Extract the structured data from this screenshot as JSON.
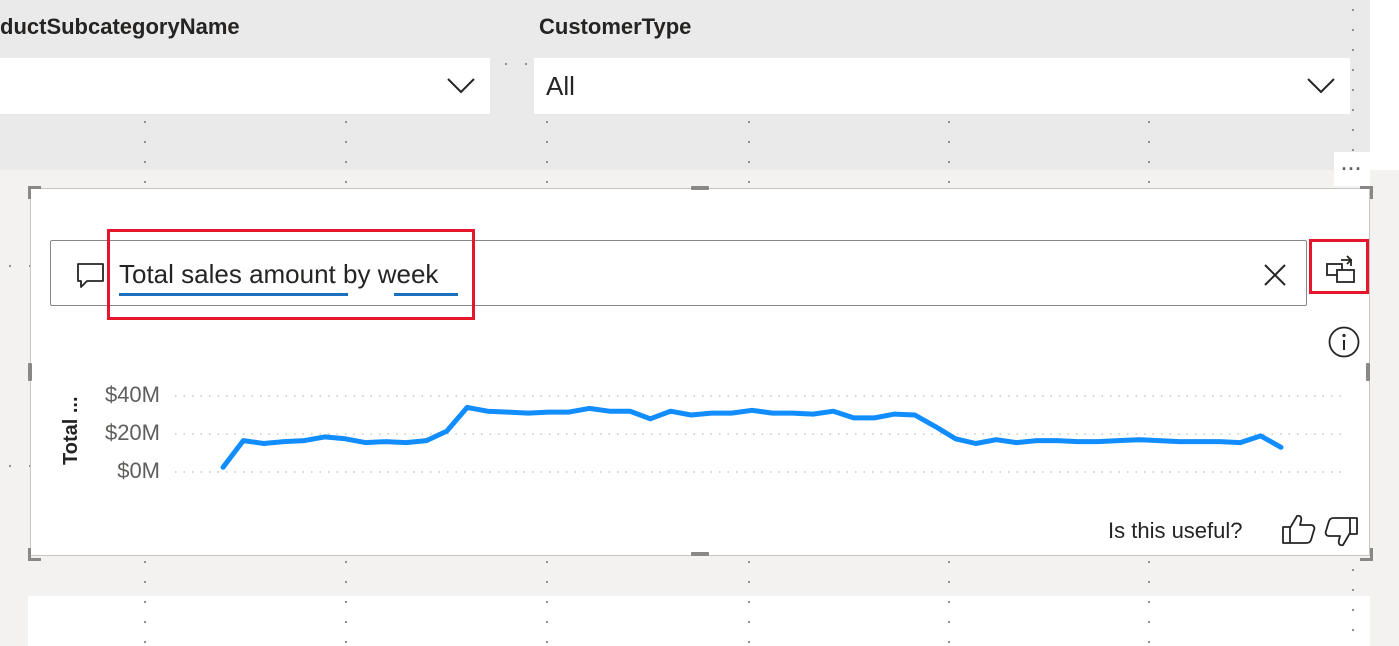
{
  "slicers": [
    {
      "title": "ductSubcategoryName",
      "value": ""
    },
    {
      "title": "CustomerType",
      "value": "All"
    }
  ],
  "qa": {
    "question": {
      "part1": "Total sales amount",
      "part2": " by ",
      "part3": "week"
    },
    "clear_icon": "close-icon",
    "convert_icon": "convert-to-visual-icon",
    "info_icon": "info-icon",
    "more_options": "···",
    "feedback": {
      "label": "Is this useful?",
      "up_icon": "thumbs-up-icon",
      "down_icon": "thumbs-down-icon"
    }
  },
  "accent_color": "#118dff",
  "highlight_color": "#e3162b",
  "chart_data": {
    "type": "line",
    "title": "",
    "xlabel": "",
    "ylabel": "Total ...",
    "yticks": [
      "$40M",
      "$20M",
      "$0M"
    ],
    "ylim": [
      0,
      40
    ],
    "grid": true,
    "series": [
      {
        "values": [
          2.5,
          16.5,
          15,
          16,
          16.5,
          18.5,
          17.5,
          15.5,
          16,
          15.5,
          16.5,
          21.5,
          34,
          32,
          31.5,
          31,
          31.5,
          31.5,
          33.5,
          32,
          32,
          28,
          32,
          30,
          31,
          31,
          32.5,
          31,
          31,
          30.5,
          32,
          28.5,
          28.5,
          30.5,
          30,
          24,
          17.5,
          15,
          17,
          15.5,
          16.5,
          16.5,
          16,
          16,
          16.5,
          17,
          16.5,
          16,
          16,
          16,
          15.5,
          19,
          13
        ]
      }
    ]
  }
}
